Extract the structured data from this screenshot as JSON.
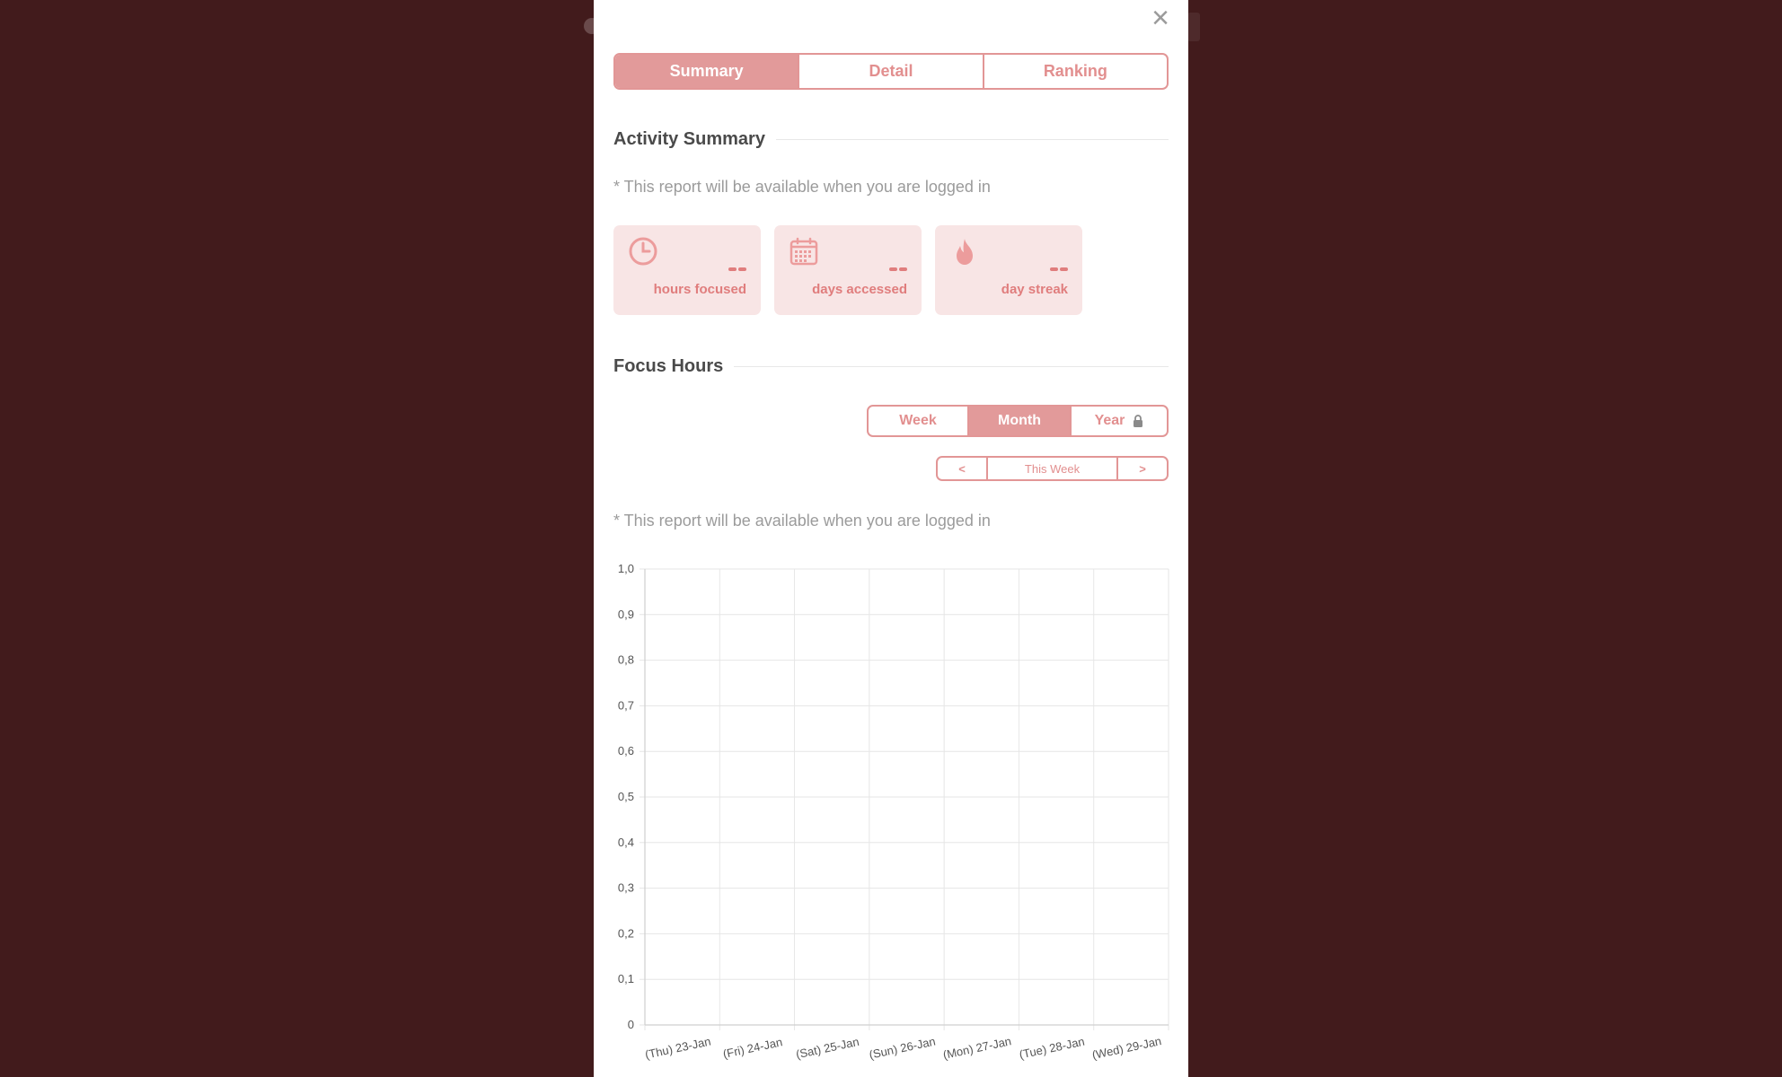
{
  "modal": {
    "close_label": "×",
    "tabs": [
      {
        "label": "Summary",
        "active": true
      },
      {
        "label": "Detail",
        "active": false
      },
      {
        "label": "Ranking",
        "active": false
      }
    ]
  },
  "activity": {
    "title": "Activity Summary",
    "note": "* This report will be available when you are logged in",
    "cards": [
      {
        "icon": "clock-icon",
        "value": "--",
        "label": "hours focused"
      },
      {
        "icon": "calendar-icon",
        "value": "--",
        "label": "days accessed"
      },
      {
        "icon": "flame-icon",
        "value": "--",
        "label": "day streak"
      }
    ]
  },
  "focus": {
    "title": "Focus Hours",
    "period_tabs": [
      {
        "label": "Week",
        "active": false
      },
      {
        "label": "Month",
        "active": true
      },
      {
        "label": "Year",
        "active": false,
        "locked": true
      }
    ],
    "nav": {
      "prev": "<",
      "current": "This Week",
      "next": ">"
    },
    "note": "* This report will be available when you are logged in"
  },
  "colors": {
    "accent": "#e29a9a",
    "accent_text": "#e07d7d",
    "card_bg": "#f8e5e5",
    "backdrop": "#421b1c"
  },
  "chart_data": {
    "type": "bar",
    "categories": [
      "(Thu) 23-Jan",
      "(Fri) 24-Jan",
      "(Sat) 25-Jan",
      "(Sun) 26-Jan",
      "(Mon) 27-Jan",
      "(Tue) 28-Jan",
      "(Wed) 29-Jan"
    ],
    "values": [
      0,
      0,
      0,
      0,
      0,
      0,
      0
    ],
    "ylim": [
      0,
      1
    ],
    "yticks": [
      "0",
      "0,1",
      "0,2",
      "0,3",
      "0,4",
      "0,5",
      "0,6",
      "0,7",
      "0,8",
      "0,9",
      "1,0"
    ],
    "grid": true
  }
}
